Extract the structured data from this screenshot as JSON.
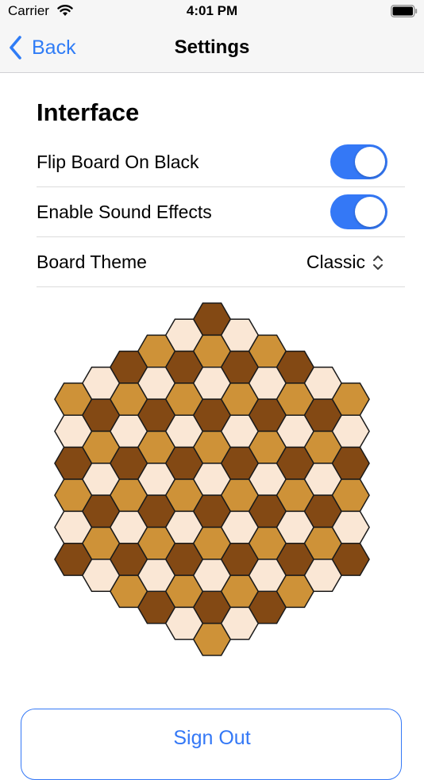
{
  "status_bar": {
    "carrier": "Carrier",
    "time": "4:01 PM"
  },
  "nav": {
    "back_label": "Back",
    "title": "Settings"
  },
  "interface": {
    "header": "Interface",
    "flip_board_label": "Flip Board On Black",
    "flip_board_on": true,
    "sound_effects_label": "Enable Sound Effects",
    "sound_effects_on": true,
    "board_theme_label": "Board Theme",
    "board_theme_value": "Classic"
  },
  "board": {
    "radius": 5,
    "colors": {
      "light": "#fae7d5",
      "medium": "#ce9238",
      "dark": "#834914",
      "outline": "#1a1a1a"
    }
  },
  "sign_out_label": "Sign Out",
  "colors": {
    "accent": "#3478f6",
    "bar_background": "#f6f6f6"
  }
}
